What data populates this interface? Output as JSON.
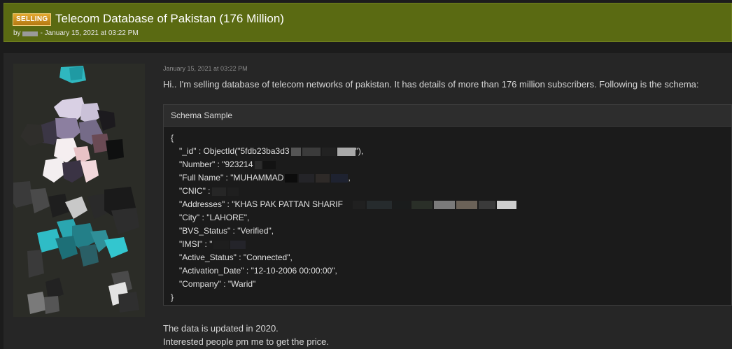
{
  "thread": {
    "badge": "SELLING",
    "title": "Telecom Database of Pakistan (176 Million)",
    "by_label": "by",
    "date": "- January 15, 2021 at 03:22 PM"
  },
  "post": {
    "date": "January 15, 2021 at 03:22 PM",
    "intro": "Hi.. I'm selling database of telecom networks of pakistan. It has details of more than 176 million subscribers. Following is the schema:",
    "code_title": "Schema Sample",
    "code_lines": [
      "{",
      "\"_id\" : ObjectId(\"5fdb23ba3d3",
      "\"Number\" : \"923214",
      "\"Full Name\" : \"MUHAMMAD",
      "\"CNIC\" :",
      "\"Addresses\" : \"KHAS PAK PATTAN SHARIF",
      "\"City\" : \"LAHORE\",",
      "\"BVS_Status\" : \"Verified\",",
      "\"IMSI\" : \"",
      "\"Active_Status\" : \"Connected\",",
      "\"Activation_Date\" : \"12-10-2006 00:00:00\",",
      "\"Company\" : \"Warid\"",
      "}"
    ],
    "id_suffix": "\"),",
    "name_suffix": ",",
    "footer_line1": "The data is updated in 2020.",
    "footer_line2": "Interested people pm me to get the price."
  },
  "colors": {
    "header_bg": "#5a6a12",
    "badge": "#d49a28",
    "page_bg": "#1c1c1c",
    "post_bg": "#262626"
  }
}
